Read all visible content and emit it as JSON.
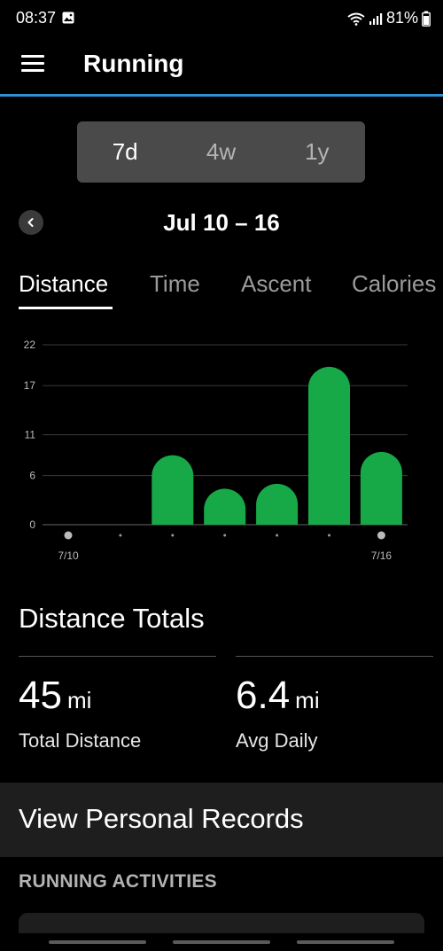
{
  "status": {
    "time": "08:37",
    "battery": "81%"
  },
  "app_bar": {
    "title": "Running"
  },
  "range_toggle": {
    "options": [
      "7d",
      "4w",
      "1y"
    ],
    "selected": "7d"
  },
  "date_nav": {
    "range": "Jul 10 – 16"
  },
  "metric_tabs": [
    "Distance",
    "Time",
    "Ascent",
    "Calories"
  ],
  "chart_data": {
    "type": "bar",
    "categories": [
      "7/10",
      "7/11",
      "7/12",
      "7/13",
      "7/14",
      "7/15",
      "7/16"
    ],
    "values": [
      0,
      0,
      8.5,
      4.4,
      5.0,
      19.3,
      8.9
    ],
    "x_tick_labels": [
      "7/10",
      "",
      "",
      "",
      "",
      "",
      "7/16"
    ],
    "y_ticks": [
      "0",
      "6",
      "11",
      "17",
      "22"
    ],
    "ylim": [
      0,
      22
    ],
    "bar_color": "#17a847",
    "grid": true,
    "title": "",
    "xlabel": "",
    "ylabel": ""
  },
  "totals": {
    "title": "Distance Totals",
    "total": {
      "value": "45",
      "unit": "mi",
      "label": "Total Distance"
    },
    "avg": {
      "value": "6.4",
      "unit": "mi",
      "label": "Avg Daily"
    }
  },
  "records": {
    "label": "View Personal Records"
  },
  "activities": {
    "header": "RUNNING ACTIVITIES"
  },
  "colors": {
    "accent": "#2d8fd6",
    "bar": "#17a847",
    "panel": "#1e1e1e"
  }
}
